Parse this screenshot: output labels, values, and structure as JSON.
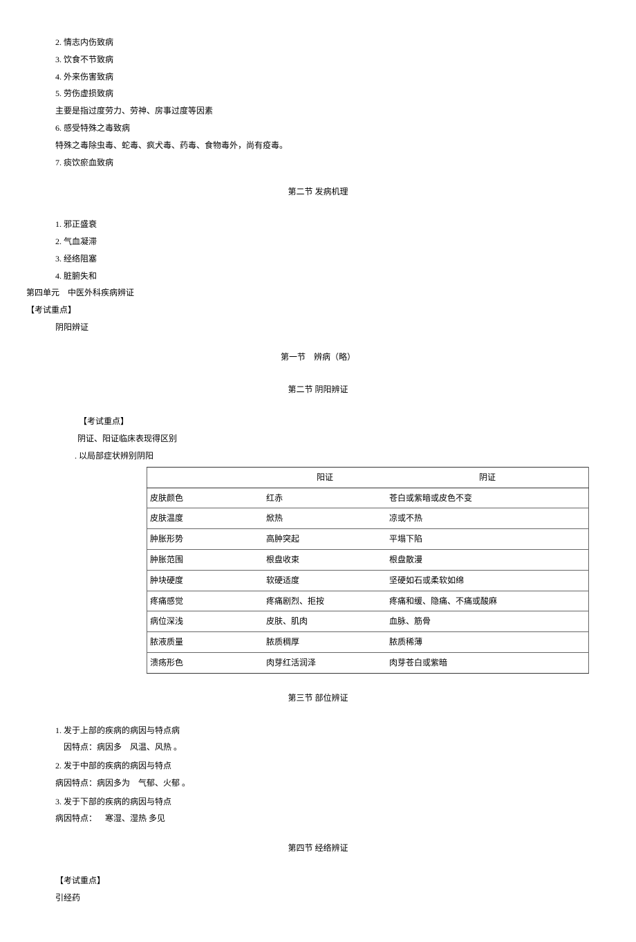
{
  "list1": [
    "2. 情志内伤致病",
    "3. 饮食不节致病",
    "4. 外来伤害致病",
    "5. 劳伤虚损致病",
    "主要是指过度劳力、劳神、房事过度等因素",
    "6. 感受特殊之毒致病",
    "特殊之毒除虫毒、蛇毒、疯犬毒、药毒、食物毒外，尚有疫毒。",
    "7. 痰饮瘀血致病"
  ],
  "section2_title": "第二节  发病机理",
  "list2": [
    "1. 邪正盛衰",
    "2. 气血凝滞",
    "3. 经络阻塞",
    "4. 脏腑失和"
  ],
  "unit4_title": "第四单元 中医外科疾病辨证",
  "exam_key_label": "【考试重点】",
  "yinyang_label": "阴阳辨证",
  "section_s1": "第一节 辨病（略）",
  "section_s2": "第二节  阴阳辨证",
  "exam_key2_label": "【考试重点】",
  "exam_key2_desc": "阴证、阳证临床表现得区别",
  "local_symptom": ". 以局部症状辨别阴阳",
  "table": {
    "headers": [
      "",
      "阳证",
      "阴证"
    ],
    "rows": [
      [
        "皮肤颜色",
        "红赤",
        "苍白或紫暗或皮色不变"
      ],
      [
        "皮肤温度",
        "焮热",
        "凉或不热"
      ],
      [
        "肿胀形势",
        "高肿突起",
        "平塌下陷"
      ],
      [
        "肿胀范围",
        "根盘收束",
        "根盘散漫"
      ],
      [
        "肿块硬度",
        "软硬适度",
        "坚硬如石或柔软如绵"
      ],
      [
        "疼痛感觉",
        "疼痛剧烈、拒按",
        "疼痛和缓、隐痛、不痛或酸麻"
      ],
      [
        "病位深浅",
        "皮肤、肌肉",
        "血脉、筋骨"
      ],
      [
        "脓液质量",
        "脓质稠厚",
        "脓质稀薄"
      ],
      [
        "溃疡形色",
        "肉芽红活润泽",
        "肉芽苍白或紫暗"
      ]
    ]
  },
  "section_s3": "第三节  部位辨证",
  "part3_list": [
    "1. 发于上部的疾病的病因与特点病",
    " 因特点：病因多 风温、风热 。",
    "2. 发于中部的疾病的病因与特点",
    "病因特点：病因多为 气郁、火郁 。",
    "3. 发于下部的疾病的病因与特点",
    "病因特点： 寒湿、湿热  多见"
  ],
  "section_s4": "第四节  经络辨证",
  "exam_key3_label": "【考试重点】",
  "exam_key3_desc": "引经药"
}
